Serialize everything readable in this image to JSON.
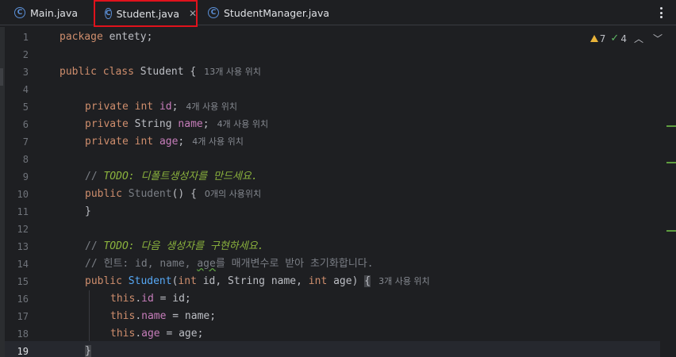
{
  "tabs": [
    {
      "label": "Main.java",
      "icon": "java-main-class-icon",
      "active": false
    },
    {
      "label": "Student.java",
      "icon": "java-class-icon",
      "active": true
    },
    {
      "label": "StudentManager.java",
      "icon": "java-class-icon",
      "active": false
    }
  ],
  "inspections": {
    "warnings": "7",
    "weak_warnings": "4"
  },
  "line_numbers": [
    "1",
    "2",
    "3",
    "4",
    "5",
    "6",
    "7",
    "8",
    "9",
    "10",
    "11",
    "12",
    "13",
    "14",
    "15",
    "16",
    "17",
    "18",
    "19"
  ],
  "current_line": "19",
  "code": {
    "l1_kw": "package",
    "l1_rest": " entety;",
    "l3_kw1": "public",
    "l3_kw2": "class",
    "l3_rest": " Student {",
    "l3_hint": "13개 사용 위치",
    "l5_kw": "private",
    "l5_type": "int",
    "l5_name": "id",
    "l5_semi": ";",
    "l5_hint": "4개 사용 위치",
    "l6_kw": "private",
    "l6_type": " String ",
    "l6_name": "name",
    "l6_semi": ";",
    "l6_hint": "4개 사용 위치",
    "l7_kw": "private",
    "l7_type": "int",
    "l7_name": "age",
    "l7_semi": ";",
    "l7_hint": "4개 사용 위치",
    "l9_cmt": "// ",
    "l9_todo": "TODO: 디폴트생성자를 만드세요.",
    "l10_kw": "public",
    "l10_name": "Student",
    "l10_rest": "() {",
    "l10_hint": "0개의 사용위치",
    "l11": "}",
    "l13_cmt": "// ",
    "l13_todo": "TODO: 다음 생성자를 구현하세요.",
    "l14_a": "// 힌트: id, name, ",
    "l14_sq": "age",
    "l14_b": "를 매개변수로 받아 초기화합니다.",
    "l15_kw": "public",
    "l15_name": "Student",
    "l15_p1": "(",
    "l15_t1": "int",
    "l15_p2": " id, String name, ",
    "l15_t2": "int",
    "l15_p3": " age) ",
    "l15_brace": "{",
    "l15_hint": "3개 사용 위치",
    "l16_this": "this",
    "l16_dot": ".",
    "l16_fld": "id",
    "l16_rest": " = id;",
    "l17_this": "this",
    "l17_dot": ".",
    "l17_fld": "name",
    "l17_rest": " = name;",
    "l18_this": "this",
    "l18_dot": ".",
    "l18_fld": "age",
    "l18_rest": " = age;",
    "l19": "}"
  },
  "colors": {
    "keyword": "#cf8e6d",
    "field": "#c77dbb",
    "function": "#56a8f5",
    "todo": "#8bb33d",
    "accent": "#3574f0",
    "highlight_box": "#e0121c"
  }
}
